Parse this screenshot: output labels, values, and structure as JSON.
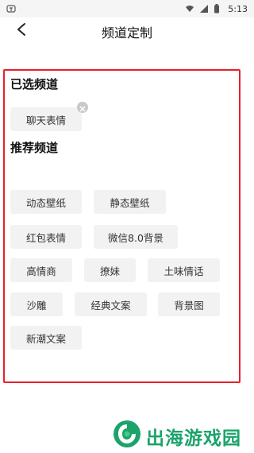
{
  "status_bar": {
    "left_icon": "app-notification-icon",
    "time": "5:13"
  },
  "header": {
    "title": "频道定制"
  },
  "selected": {
    "title": "已选频道",
    "items": [
      {
        "label": "聊天表情"
      }
    ]
  },
  "recommended": {
    "title": "推荐频道",
    "items": [
      {
        "label": "动态壁纸"
      },
      {
        "label": "静态壁纸"
      },
      {
        "label": "红包表情"
      },
      {
        "label": "微信8.0背景"
      },
      {
        "label": "高情商"
      },
      {
        "label": "撩妹"
      },
      {
        "label": "土味情话"
      },
      {
        "label": "沙雕"
      },
      {
        "label": "经典文案"
      },
      {
        "label": "背景图"
      },
      {
        "label": "新潮文案"
      }
    ]
  },
  "watermark": {
    "text": "出海游戏园"
  },
  "colors": {
    "highlight_frame": "#e8202a",
    "chip_bg": "#f2f2f2",
    "watermark_green": "#1ba36a"
  }
}
